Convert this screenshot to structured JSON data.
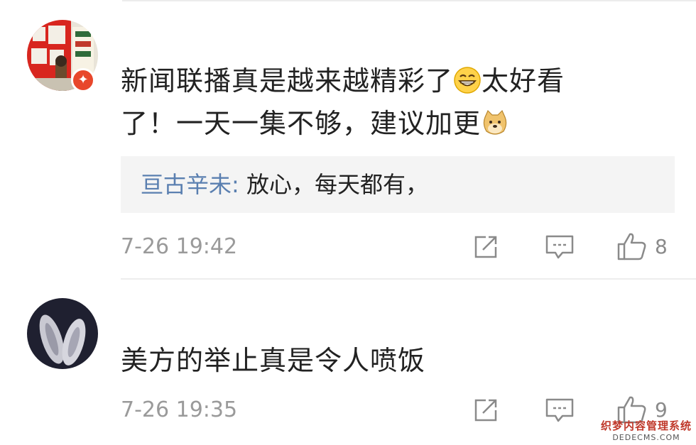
{
  "comments": [
    {
      "text_line1": "新闻联播真是越来越精彩了",
      "text_line1_tail": "太好看",
      "text_line2": "了！一天一集不够，建议加更",
      "emoji1": "grinning-face-emoji",
      "emoji2": "doge-emoji",
      "reply": {
        "user": "亘古辛未",
        "separator": ":",
        "message": " 放心，每天都有，"
      },
      "timestamp": "7-26 19:42",
      "likes": "8"
    },
    {
      "text_line1": "美方的举止真是令人喷饭",
      "timestamp": "7-26 19:35",
      "likes": "9"
    }
  ],
  "watermark": {
    "line1": "织梦内容管理系统",
    "line2": "DEDECMS.COM"
  },
  "colors": {
    "reply_user": "#5a7fb0",
    "meta": "#9a9a9a",
    "badge": "#e8472b",
    "reply_bg": "#f4f4f4"
  }
}
